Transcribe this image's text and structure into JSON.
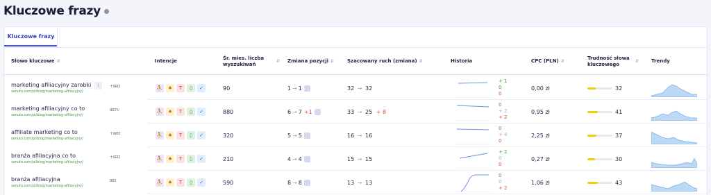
{
  "page": {
    "title": "Kluczowe frazy"
  },
  "tabs": [
    {
      "label": "Kluczowe frazy"
    }
  ],
  "columns": {
    "keyword": "Słowo kluczowe",
    "intents": "Intencje",
    "volume": "Śr. mies. liczba wyszukiwań",
    "position": "Zmiana pozycji",
    "traffic": "Szacowany ruch (zmiana)",
    "history": "Historia",
    "cpc": "CPC (PLN)",
    "difficulty": "Trudność słowa kluczowego",
    "trends": "Trendy"
  },
  "colors": {
    "accent": "#4250e0",
    "up": "#3aa03a",
    "down": "#e0483a",
    "kd": "#f0d000"
  },
  "intent_icons": [
    "people-icon",
    "spade-icon",
    "text-t-icon",
    "phone-icon",
    "check-icon"
  ],
  "rows": [
    {
      "keyword": "marketing afiliacyjny zarobki",
      "url": "senuto.com/pl/blog/marketing-afiliacyjny/",
      "icons": "+⁞⊞⊡",
      "volume": "90",
      "pos_from": "1",
      "pos_to": "1",
      "pos_change": "",
      "traffic_from": "32",
      "traffic_to": "32",
      "traffic_change": "",
      "hist": [
        "+ 1",
        "0",
        "0"
      ],
      "hist_class": [
        "g",
        "g",
        "r"
      ],
      "cpc": "0,00 zł",
      "kd": "32",
      "kd_frac": 0.32
    },
    {
      "keyword": "marketing afiliacyjny co to",
      "url": "senuto.com/pl/blog/marketing-afiliacyjny/",
      "icons": "⊞⊡↻",
      "volume": "880",
      "pos_from": "6",
      "pos_to": "7",
      "pos_change": "+1",
      "traffic_from": "33",
      "traffic_to": "25",
      "traffic_change": "+ 8",
      "hist": [
        "0",
        "+ 2",
        "+ 2"
      ],
      "hist_class": [
        "g",
        "gr",
        "r"
      ],
      "cpc": "0,95 zł",
      "kd": "41",
      "kd_frac": 0.41
    },
    {
      "keyword": "affiliate marketing co to",
      "url": "senuto.com/pl/blog/marketing-afiliacyjny/",
      "icons": "+⁞⊞⊡",
      "volume": "320",
      "pos_from": "5",
      "pos_to": "5",
      "pos_change": "",
      "traffic_from": "16",
      "traffic_to": "16",
      "traffic_change": "",
      "hist": [
        "0",
        "+ 4",
        "0"
      ],
      "hist_class": [
        "g",
        "gr",
        "r"
      ],
      "cpc": "2,25 zł",
      "kd": "37",
      "kd_frac": 0.37
    },
    {
      "keyword": "branża afiliacyjna co to",
      "url": "senuto.com/pl/blog/marketing-afiliacyjny/",
      "icons": "+⁞⊞⊡",
      "volume": "210",
      "pos_from": "4",
      "pos_to": "4",
      "pos_change": "",
      "traffic_from": "15",
      "traffic_to": "15",
      "traffic_change": "",
      "hist": [
        "+ 2",
        "0",
        "0"
      ],
      "hist_class": [
        "g",
        "gr",
        "r"
      ],
      "cpc": "0,27 zł",
      "kd": "30",
      "kd_frac": 0.3
    },
    {
      "keyword": "branża afiliacyjna",
      "url": "senuto.com/pl/blog/marketing-afiliacyjny/",
      "icons": "⊞⊡",
      "volume": "590",
      "pos_from": "8",
      "pos_to": "8",
      "pos_change": "",
      "traffic_from": "13",
      "traffic_to": "13",
      "traffic_change": "",
      "hist": [
        "0",
        "0",
        "+ 2"
      ],
      "hist_class": [
        "g",
        "gr",
        "r"
      ],
      "cpc": "1,06 zł",
      "kd": "43",
      "kd_frac": 0.43
    }
  ]
}
